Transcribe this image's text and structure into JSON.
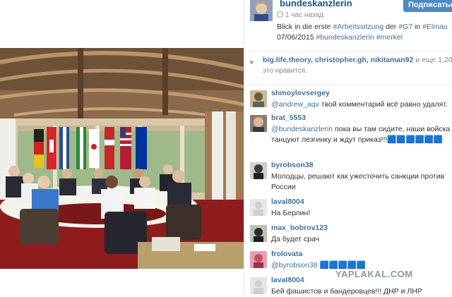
{
  "post": {
    "username": "bundeskanzlerin",
    "follow_label": "Подписаться",
    "time_ago": "1 час назад",
    "caption_line1_text": "Blick in die erste ",
    "caption_tag1": "#Arbeitssitzung",
    "caption_line1_mid": " der ",
    "caption_tag2": "#G7",
    "caption_line1_in": " in ",
    "caption_tag3": "#Elmau",
    "caption_line2_date": "07/06/2015 ",
    "caption_tag4": "#bundeskanzlerin",
    "caption_tag5": "#merkel"
  },
  "likes": {
    "users": "big.life.theory, christopher.gh, nikitaman92",
    "more": " и еще 1,20",
    "text": "это нравится."
  },
  "comments": [
    {
      "user": "shmoylovsergey",
      "mention": "@andrew_aqv",
      "text": " твой комментарий всё равно удалят."
    },
    {
      "user": "brat_5553",
      "mention": "@bundeskanzlerin",
      "text": " пока вы там сидите, наши войска танцуют лезгинку и ждут приказ!!!🟦🟦🟦🟦🟦🟦"
    },
    {
      "user": "byrobson38",
      "mention": "",
      "text": "Молодцы, решают как ужесточить санкции против России"
    },
    {
      "user": "laval8004",
      "mention": "",
      "text": "На Берлин!"
    },
    {
      "user": "max_bobrov123",
      "mention": "",
      "text": "Да будет срач"
    },
    {
      "user": "frolovata",
      "mention": "@byrobson38",
      "text": " 🟦🟦🟦🟦🟦"
    },
    {
      "user": "laval8004",
      "mention": "",
      "text": "Бей фашистов и бандеровцев!!! ДНР и ЛНР"
    }
  ],
  "watermark": "YAPLAKAL.COM",
  "colors": {
    "link": "#3f729b",
    "username": "#125688",
    "button": "#4a8bc2"
  }
}
